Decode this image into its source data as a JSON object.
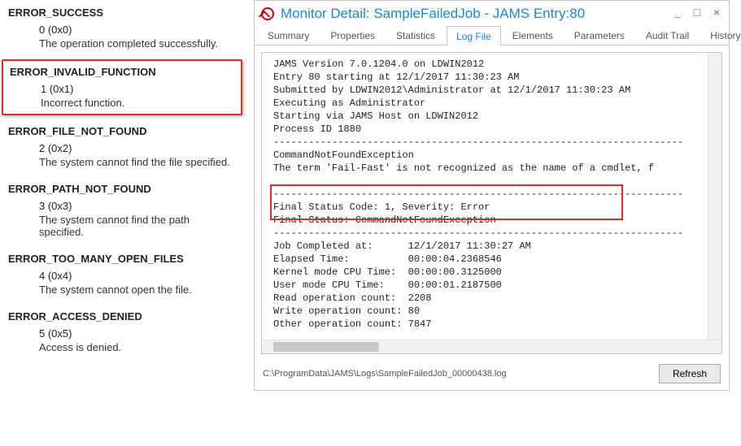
{
  "errors": [
    {
      "title": "ERROR_SUCCESS",
      "code": "0 (0x0)",
      "desc": "The operation completed successfully."
    },
    {
      "title": "ERROR_INVALID_FUNCTION",
      "code": "1 (0x1)",
      "desc": "Incorrect function.",
      "highlight": true
    },
    {
      "title": "ERROR_FILE_NOT_FOUND",
      "code": "2 (0x2)",
      "desc": "The system cannot find the file specified."
    },
    {
      "title": "ERROR_PATH_NOT_FOUND",
      "code": "3 (0x3)",
      "desc": "The system cannot find the path specified."
    },
    {
      "title": "ERROR_TOO_MANY_OPEN_FILES",
      "code": "4 (0x4)",
      "desc": "The system cannot open the file."
    },
    {
      "title": "ERROR_ACCESS_DENIED",
      "code": "5 (0x5)",
      "desc": "Access is denied."
    }
  ],
  "dialog": {
    "title": "Monitor Detail: SampleFailedJob - JAMS Entry:80",
    "tabs": [
      "Summary",
      "Properties",
      "Statistics",
      "Log File",
      "Elements",
      "Parameters",
      "Audit Trail",
      "History"
    ],
    "active_tab": "Log File",
    "log": {
      "header": [
        "JAMS Version 7.0.1204.0 on LDWIN2012",
        "Entry 80 starting at 12/1/2017 11:30:23 AM",
        "Submitted by LDWIN2012\\Administrator at 12/1/2017 11:30:23 AM",
        "Executing as Administrator",
        "Starting via JAMS Host on LDWIN2012",
        "Process ID 1880"
      ],
      "exception": [
        "CommandNotFoundException",
        "The term 'Fail-Fast' is not recognized as the name of a cmdlet, f"
      ],
      "final": [
        "Final Status Code: 1, Severity: Error",
        "Final Status: CommandNotFoundException"
      ],
      "stats": [
        "Job Completed at:      12/1/2017 11:30:27 AM",
        "Elapsed Time:          00:00:04.2368546",
        "Kernel mode CPU Time:  00:00:00.3125000",
        "User mode CPU Time:    00:00:01.2187500",
        "Read operation count:  2208",
        "Write operation count: 80",
        "Other operation count: 7847"
      ]
    },
    "path": "C:\\ProgramData\\JAMS\\Logs\\SampleFailedJob_00000438.log",
    "refresh": "Refresh"
  }
}
